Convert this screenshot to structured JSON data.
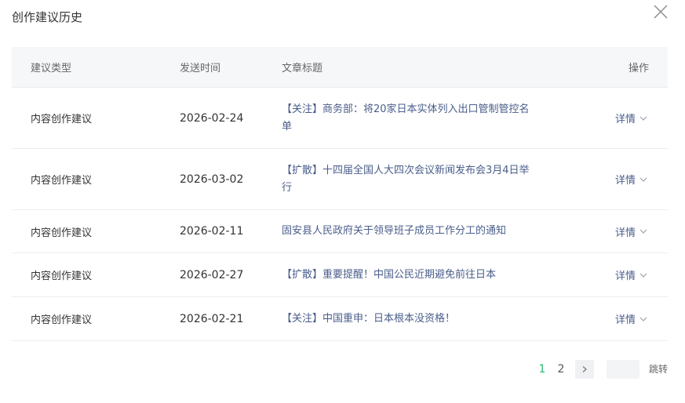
{
  "dialog": {
    "title": "创作建议历史"
  },
  "table": {
    "headers": {
      "type": "建议类型",
      "time": "发送时间",
      "title": "文章标题",
      "action": "操作"
    },
    "rows": [
      {
        "type": "内容创作建议",
        "date": "2026-02-24",
        "title": "【关注】商务部：将20家日本实体列入出口管制管控名单",
        "action": "详情"
      },
      {
        "type": "内容创作建议",
        "date": "2026-03-02",
        "title": "【扩散】十四届全国人大四次会议新闻发布会3月4日举行",
        "action": "详情"
      },
      {
        "type": "内容创作建议",
        "date": "2026-02-11",
        "title": "固安县人民政府关于领导班子成员工作分工的通知",
        "action": "详情"
      },
      {
        "type": "内容创作建议",
        "date": "2026-02-27",
        "title": "【扩散】重要提醒！中国公民近期避免前往日本",
        "action": "详情"
      },
      {
        "type": "内容创作建议",
        "date": "2026-02-21",
        "title": "【关注】中国重申：日本根本没资格！",
        "action": "详情"
      }
    ]
  },
  "pagination": {
    "pages": [
      "1",
      "2"
    ],
    "current": "1",
    "jump_value": "",
    "jump_label": "跳转"
  },
  "colors": {
    "link": "#4a5d8a",
    "active_page": "#2bb673",
    "header_bg": "#f6f7f9"
  }
}
